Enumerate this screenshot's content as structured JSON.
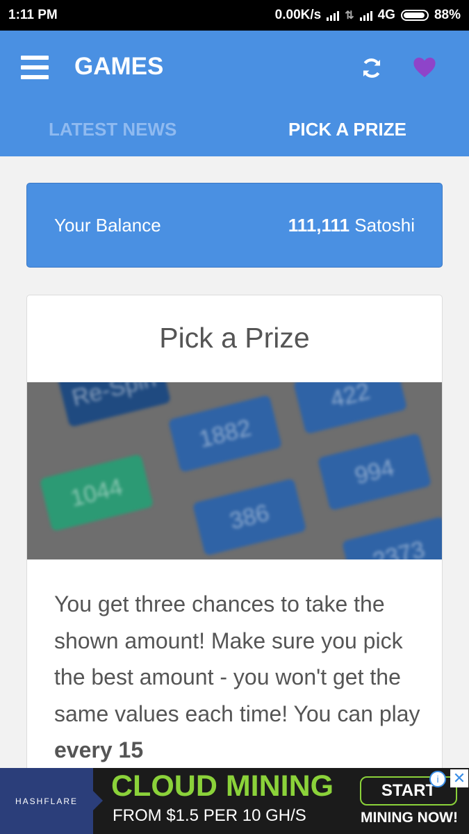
{
  "status_bar": {
    "time": "1:11 PM",
    "net_speed": "0.00K/s",
    "network": "4G",
    "battery": "88%"
  },
  "app_bar": {
    "title": "GAMES",
    "icons": [
      "menu-icon",
      "refresh-icon",
      "heart-icon"
    ],
    "tabs": [
      {
        "label": "LATEST NEWS",
        "active": false
      },
      {
        "label": "PICK A PRIZE",
        "active": true
      }
    ]
  },
  "balance": {
    "label": "Your Balance",
    "amount": "111,111",
    "unit": "Satoshi"
  },
  "card": {
    "title": "Pick a Prize",
    "image_tiles": [
      "Re-Spin",
      "1882",
      "422",
      "1044",
      "994",
      "386",
      "2373"
    ],
    "description_start": "You get three chances to take the shown amount! Make sure you pick the best amount - you won't get the same values each time! You can play ",
    "description_bold": "every 15"
  },
  "ad": {
    "brand": "HASHFLARE",
    "headline": "CLOUD MINING",
    "sub": "FROM $1.5 PER 10 GH/S",
    "button": "START",
    "button_sub": "MINING NOW!"
  },
  "colors": {
    "primary": "#4a90e2",
    "tab_inactive": "#8fbaf0",
    "heart": "#8e44c9",
    "ad_green": "#8bd23a"
  }
}
